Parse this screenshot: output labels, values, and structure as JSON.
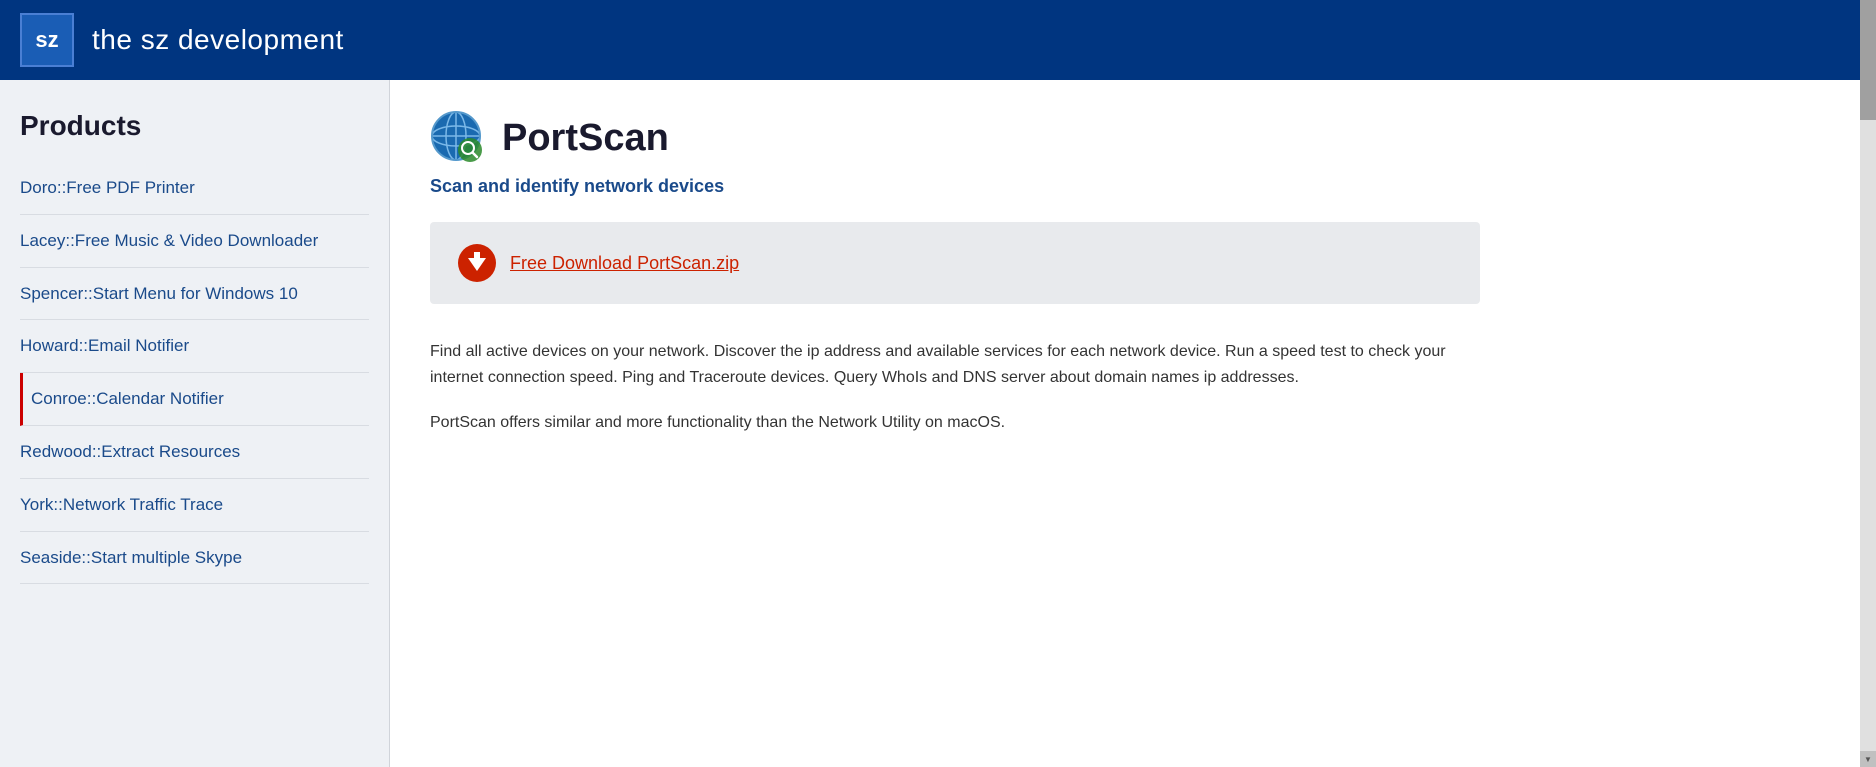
{
  "header": {
    "logo_text": "sz",
    "site_title": "the sz development"
  },
  "sidebar": {
    "section_title": "Products",
    "items": [
      {
        "id": "doro",
        "label": "Doro::Free PDF Printer",
        "active": false
      },
      {
        "id": "lacey",
        "label": "Lacey::Free Music & Video Downloader",
        "active": false
      },
      {
        "id": "spencer",
        "label": "Spencer::Start Menu for Windows 10",
        "active": false
      },
      {
        "id": "howard",
        "label": "Howard::Email Notifier",
        "active": false
      },
      {
        "id": "conroe",
        "label": "Conroe::Calendar Notifier",
        "active": true
      },
      {
        "id": "redwood",
        "label": "Redwood::Extract Resources",
        "active": false
      },
      {
        "id": "york",
        "label": "York::Network Traffic Trace",
        "active": false
      },
      {
        "id": "seaside",
        "label": "Seaside::Start multiple Skype",
        "active": false
      }
    ]
  },
  "content": {
    "page_title": "PortScan",
    "page_subtitle": "Scan and identify network devices",
    "download_label": "Free Download PortScan.zip",
    "description1": "Find all active devices on your network. Discover the ip address and available services for each network device. Run a speed test to check your internet connection speed. Ping and Traceroute devices. Query WhoIs and DNS server about domain names ip addresses.",
    "description2": "PortScan offers similar and more functionality than the Network Utility on macOS."
  }
}
